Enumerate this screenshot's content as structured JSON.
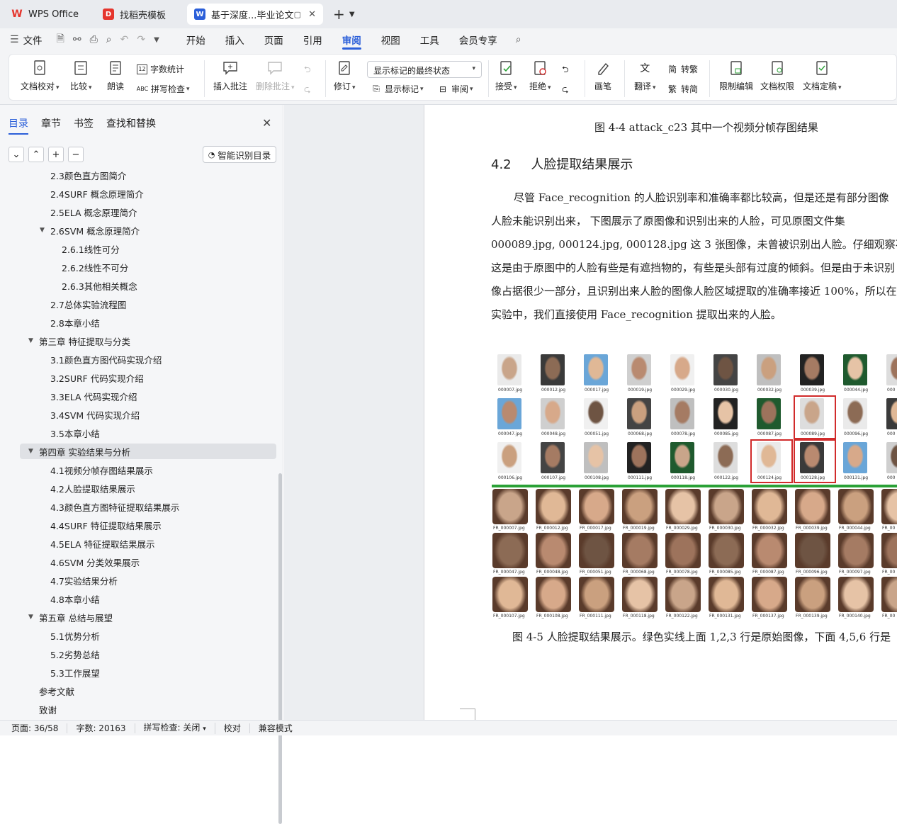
{
  "tabs": [
    {
      "label": "WPS Office",
      "icon": "wps-logo-icon",
      "color": "#e5352d"
    },
    {
      "label": "找稻壳模板",
      "icon": "docer-icon",
      "color": "#e5352d"
    },
    {
      "label": "基于深度...毕业论文",
      "icon": "word-doc-icon",
      "color": "#2b5fd9"
    }
  ],
  "menubar": {
    "file": "文件",
    "items": [
      "开始",
      "插入",
      "页面",
      "引用",
      "审阅",
      "视图",
      "工具",
      "会员专享"
    ],
    "active": "审阅"
  },
  "ribbon": {
    "doc_check": "文档校对",
    "compare": "比较",
    "read_aloud": "朗读",
    "word_count": "字数统计",
    "spell_check": "拼写检查",
    "insert_comment": "插入批注",
    "delete_comment": "删除批注",
    "revise": "修订",
    "markup_state": "显示标记的最终状态",
    "show_markup": "显示标记",
    "review": "审阅",
    "accept": "接受",
    "reject": "拒绝",
    "pen": "画笔",
    "translate": "翻译",
    "to_traditional": "转繁",
    "to_simplified": "转简",
    "restrict_edit": "限制编辑",
    "doc_permission": "文档权限",
    "finalize": "文档定稿"
  },
  "panel": {
    "tabs": [
      "目录",
      "章节",
      "书签",
      "查找和替换"
    ],
    "smart_toc": "智能识别目录",
    "toc": [
      {
        "label": "2.3颜色直方图简介",
        "level": 2
      },
      {
        "label": "2.4SURF 概念原理简介",
        "level": 2
      },
      {
        "label": "2.5ELA 概念原理简介",
        "level": 2
      },
      {
        "label": "2.6SVM 概念原理简介",
        "level": 2,
        "expanded": true
      },
      {
        "label": "2.6.1线性可分",
        "level": 3
      },
      {
        "label": "2.6.2线性不可分",
        "level": 3
      },
      {
        "label": "2.6.3其他相关概念",
        "level": 3
      },
      {
        "label": "2.7总体实验流程图",
        "level": 2
      },
      {
        "label": "2.8本章小结",
        "level": 2
      },
      {
        "label": "第三章 特征提取与分类",
        "level": 1,
        "expanded": true
      },
      {
        "label": "3.1颜色直方图代码实现介绍",
        "level": 2
      },
      {
        "label": "3.2SURF 代码实现介绍",
        "level": 2
      },
      {
        "label": "3.3ELA 代码实现介绍",
        "level": 2
      },
      {
        "label": "3.4SVM 代码实现介绍",
        "level": 2
      },
      {
        "label": "3.5本章小结",
        "level": 2
      },
      {
        "label": "第四章 实验结果与分析",
        "level": 1,
        "expanded": true,
        "selected": true
      },
      {
        "label": "4.1视频分帧存图结果展示",
        "level": 2
      },
      {
        "label": "4.2人脸提取结果展示",
        "level": 2
      },
      {
        "label": "4.3颜色直方图特征提取结果展示",
        "level": 2
      },
      {
        "label": "4.4SURF 特征提取结果展示",
        "level": 2
      },
      {
        "label": "4.5ELA 特征提取结果展示",
        "level": 2
      },
      {
        "label": "4.6SVM 分类效果展示",
        "level": 2
      },
      {
        "label": "4.7实验结果分析",
        "level": 2
      },
      {
        "label": "4.8本章小结",
        "level": 2
      },
      {
        "label": "第五章 总结与展望",
        "level": 1,
        "expanded": true
      },
      {
        "label": "5.1优势分析",
        "level": 2
      },
      {
        "label": "5.2劣势总结",
        "level": 2
      },
      {
        "label": "5.3工作展望",
        "level": 2
      },
      {
        "label": "参考文献",
        "level": 1
      },
      {
        "label": "致谢",
        "level": 1
      }
    ]
  },
  "document": {
    "caption_top": "图 4-4 attack_c23 其中一个视频分帧存图结果",
    "heading_num": "4.2",
    "heading_text": "人脸提取结果展示",
    "paragraph": [
      "尽管 Face_recognition 的人脸识别率和准确率都比较高，但是还是有部分图像",
      "人脸未能识别出来， 下图展示了原图像和识别出来的人脸，可见原图文件集",
      "000089.jpg, 000124.jpg, 000128.jpg 这 3 张图像，未曾被识别出人脸。仔细观察不难发",
      "这是由于原图中的人脸有些是有遮挡物的，有些是头部有过度的倾斜。但是由于未识别",
      "像占据很少一部分，且识别出来人脸的图像人脸区域提取的准确率接近 100%，所以在",
      "实验中，我们直接使用  Face_recognition 提取出来的人脸。"
    ],
    "figure": {
      "orig_rows": [
        [
          "000007.jpg",
          "000012.jpg",
          "000017.jpg",
          "000019.jpg",
          "000029.jpg",
          "000030.jpg",
          "000032.jpg",
          "000039.jpg",
          "000044.jpg",
          "000"
        ],
        [
          "000047.jpg",
          "000048.jpg",
          "000051.jpg",
          "000068.jpg",
          "000078.jpg",
          "000085.jpg",
          "000087.jpg",
          "000089.jpg",
          "000096.jpg",
          "000"
        ],
        [
          "000106.jpg",
          "000107.jpg",
          "000108.jpg",
          "000111.jpg",
          "000118.jpg",
          "000122.jpg",
          "000124.jpg",
          "000128.jpg",
          "000131.jpg",
          "000"
        ]
      ],
      "face_rows": [
        [
          "FR_000007.jpg",
          "FR_000012.jpg",
          "FR_000017.jpg",
          "FR_000019.jpg",
          "FR_000029.jpg",
          "FR_000030.jpg",
          "FR_000032.jpg",
          "FR_000039.jpg",
          "FR_000044.jpg",
          "FR_00"
        ],
        [
          "FR_000047.jpg",
          "FR_000048.jpg",
          "FR_000051.jpg",
          "FR_000068.jpg",
          "FR_000078.jpg",
          "FR_000085.jpg",
          "FR_000087.jpg",
          "FR_000096.jpg",
          "FR_000097.jpg",
          "FR_00"
        ],
        [
          "FR_000107.jpg",
          "FR_000108.jpg",
          "FR_000111.jpg",
          "FR_000118.jpg",
          "FR_000122.jpg",
          "FR_000131.jpg",
          "FR_000137.jpg",
          "FR_000139.jpg",
          "FR_000140.jpg",
          "FR_00"
        ]
      ],
      "highlighted_missed": [
        "000089.jpg",
        "000124.jpg",
        "000128.jpg"
      ],
      "separator_color": "#2aa136",
      "highlight_color": "#d12b2b"
    },
    "caption_bottom": "图 4-5  人脸提取结果展示。绿色实线上面  1,2,3 行是原始图像，下面  4,5,6 行是"
  },
  "status": {
    "page": "页面: 36/58",
    "words": "字数: 20163",
    "spell": "拼写检查: 关闭",
    "proof": "校对",
    "compat": "兼容模式"
  },
  "accent": "#2b5fd9"
}
